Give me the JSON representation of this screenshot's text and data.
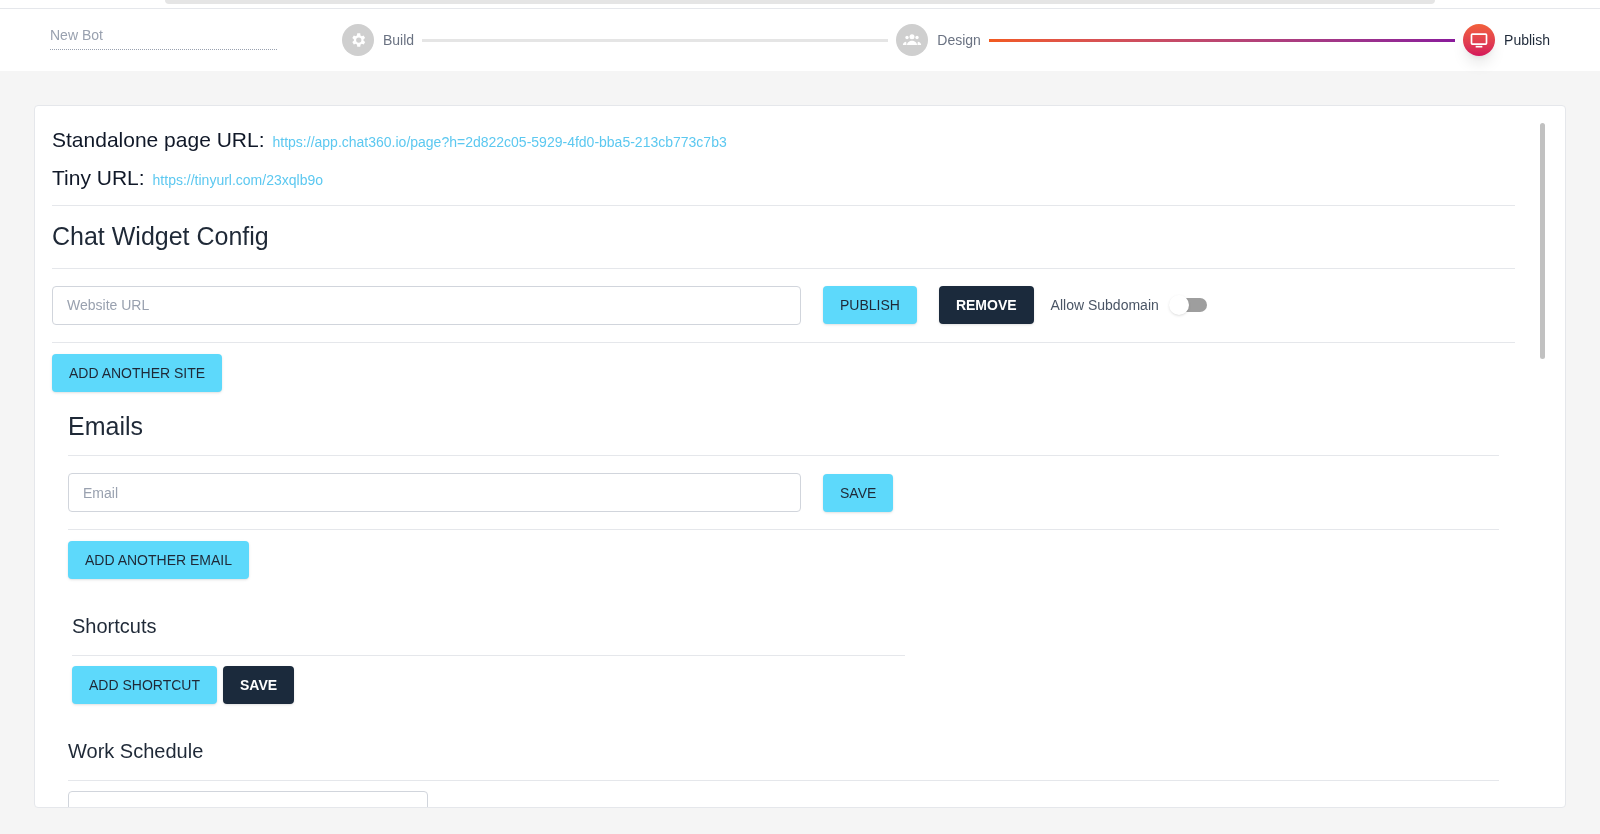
{
  "bot_name": {
    "placeholder": "New Bot"
  },
  "steps": [
    {
      "label": "Build",
      "kind": "gear",
      "selected": false
    },
    {
      "label": "Design",
      "kind": "people",
      "selected": false
    },
    {
      "label": "Publish",
      "kind": "monitor",
      "selected": true
    }
  ],
  "links": [
    {
      "label": "Standalone page URL:",
      "url": "https://app.chat360.io/page?h=2d822c05-5929-4fd0-bba5-213cb773c7b3"
    },
    {
      "label": "Tiny URL:",
      "url": "https://tinyurl.com/23xqlb9o"
    }
  ],
  "widget": {
    "title": "Chat Widget Config",
    "url_field": {
      "placeholder": "Website URL"
    },
    "publish": "PUBLISH",
    "remove": "REMOVE",
    "toggle": {
      "label": "Allow Subdomain",
      "on": false
    },
    "add_site": "ADD ANOTHER SITE"
  },
  "emails": {
    "title": "Emails",
    "field": {
      "placeholder": "Email"
    },
    "save": "SAVE",
    "add": "ADD ANOTHER EMAIL"
  },
  "shortcuts": {
    "title": "Shortcuts",
    "add": "ADD SHORTCUT",
    "save": "SAVE"
  },
  "work_schedule": {
    "title": "Work Schedule"
  }
}
